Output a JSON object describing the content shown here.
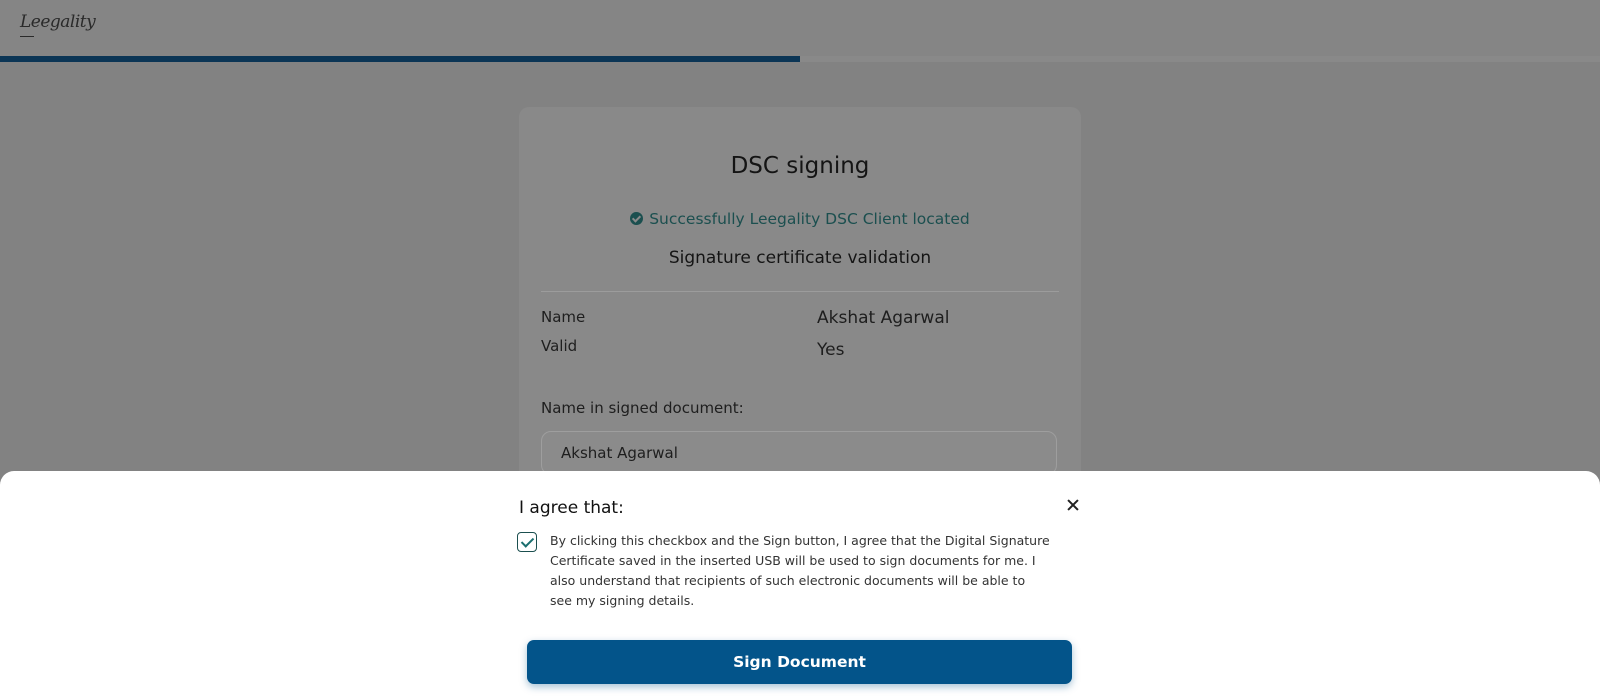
{
  "header": {
    "logo_text": "Leegality",
    "progress_fraction": 0.5
  },
  "card": {
    "title": "DSC signing",
    "status_message": "Successfully Leegality DSC Client located",
    "subtitle": "Signature certificate validation",
    "rows": [
      {
        "label": "Name",
        "value": "Akshat Agarwal"
      },
      {
        "label": "Valid",
        "value": "Yes"
      }
    ],
    "name_field_label": "Name in signed document:",
    "name_field_value": "Akshat Agarwal"
  },
  "consent": {
    "title": "I agree that:",
    "checkbox_checked": true,
    "text": "By clicking this checkbox and the Sign button, I agree that the Digital Signature Certificate saved in the inserted USB will be used to sign documents for me. I also understand that recipients of such electronic documents will be able to see my signing details.",
    "sign_button_label": "Sign Document"
  },
  "colors": {
    "progress": "#0b3555",
    "success": "#1b4f4f",
    "primary_button": "#03548a"
  },
  "icons": {
    "status": "check-circle-icon",
    "checkbox": "checkmark-icon",
    "close": "close-icon"
  }
}
